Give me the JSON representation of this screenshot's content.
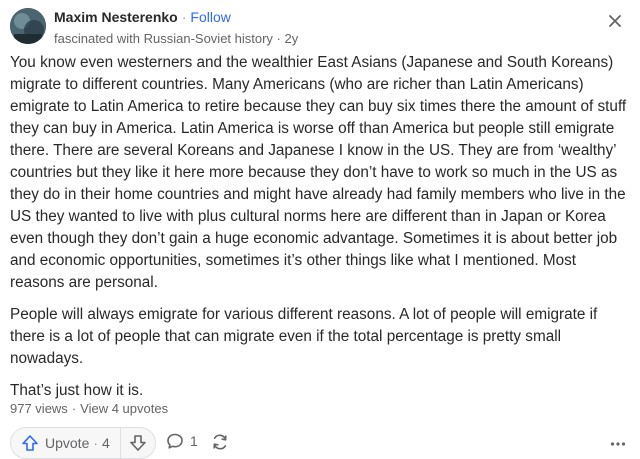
{
  "author": {
    "name": "Maxim Nesterenko",
    "separator": "·",
    "follow_label": "Follow",
    "credential": "fascinated with Russian-Soviet history · 2y"
  },
  "answer": {
    "paragraphs": [
      "You know even westerners and the wealthier East Asians (Japanese and South Koreans) migrate to different countries. Many Americans (who are richer than Latin Americans) emigrate to Latin America to retire because they can buy six times there the amount of stuff they can buy in America. Latin America is worse off than America but people still emigrate there. There are several Koreans and Japanese I know in the US. They are from ‘wealthy’ countries but they like it here more because they don’t have to work so much in the US as they do in their home countries and might have already had family members who live in the US they wanted to live with plus cultural norms here are different than in Japan or Korea even though they don’t gain a huge economic advantage. Sometimes it is about better job and economic opportunities, sometimes it’s other things like what I mentioned. Most reasons are personal.",
      "People will always emigrate for various different reasons. A lot of people will emigrate if there is a lot of people that can migrate even if the total percentage is pretty small nowadays.",
      "That’s just how it is."
    ]
  },
  "stats": {
    "views": "977 views",
    "separator": "·",
    "upvotes_link": "View 4 upvotes"
  },
  "actions": {
    "upvote_label": "Upvote",
    "upvote_separator": "·",
    "upvote_count": "4",
    "comment_count": "1",
    "icons": {
      "close": "close-icon",
      "upvote": "arrow-up-icon",
      "downvote": "arrow-down-icon",
      "comment": "comment-bubble-icon",
      "share": "share-arrows-icon",
      "more": "more-dots-icon"
    }
  },
  "colors": {
    "accent": "#2e69ff",
    "text": "#282829",
    "muted": "#636466"
  }
}
